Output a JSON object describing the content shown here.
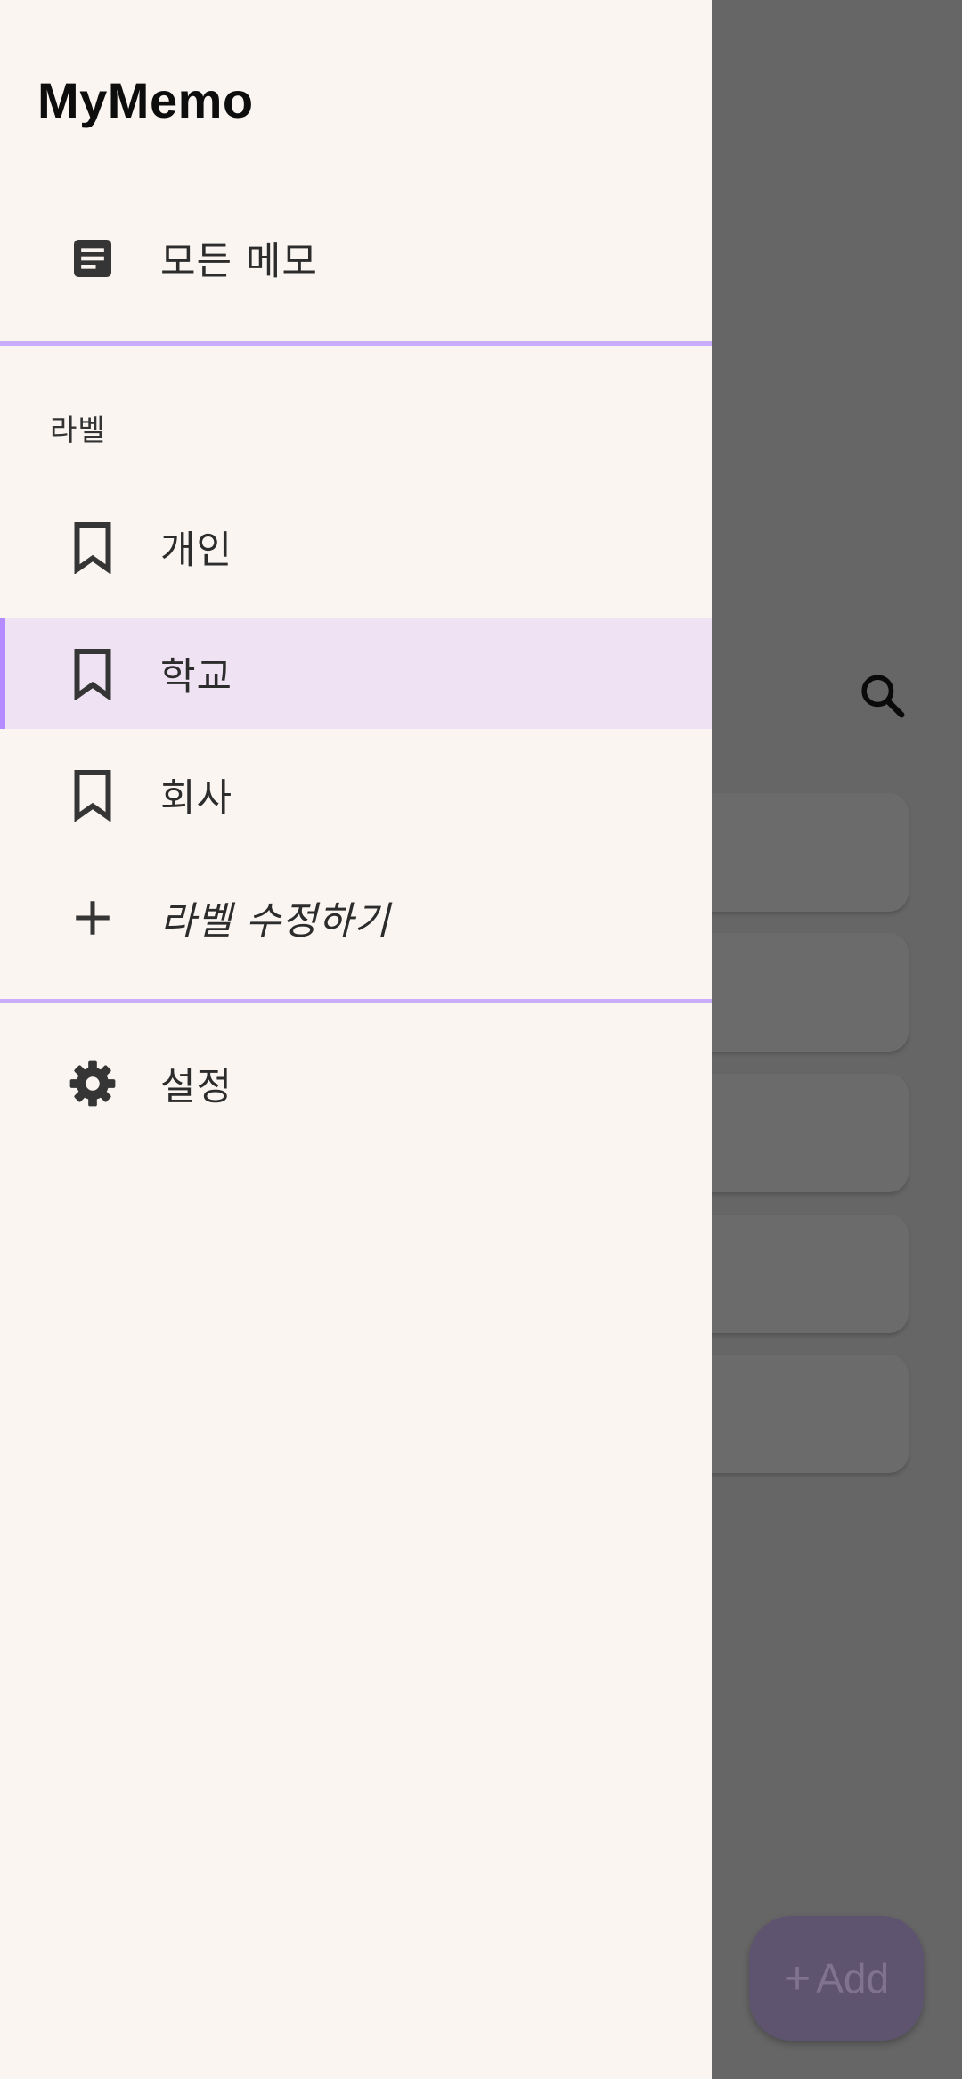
{
  "app": {
    "title": "MyMemo"
  },
  "drawer": {
    "all_memos": {
      "label": "모든 메모",
      "icon": "notes-icon"
    },
    "labels_header": "라벨",
    "labels": [
      {
        "label": "개인",
        "icon": "bookmark-icon",
        "selected": false
      },
      {
        "label": "학교",
        "icon": "bookmark-icon",
        "selected": true
      },
      {
        "label": "회사",
        "icon": "bookmark-icon",
        "selected": false
      }
    ],
    "edit_labels": {
      "label": "라벨 수정하기",
      "icon": "plus-icon"
    },
    "settings": {
      "label": "설정",
      "icon": "gear-icon"
    }
  },
  "background": {
    "search_icon": "search-icon",
    "fab_label": "Add",
    "fab_icon": "+"
  },
  "colors": {
    "drawer_bg": "#faf5f1",
    "selected_bg": "#efe3f3",
    "accent": "#b48cff",
    "divider": "#c9adff",
    "scrim": "#666666"
  }
}
